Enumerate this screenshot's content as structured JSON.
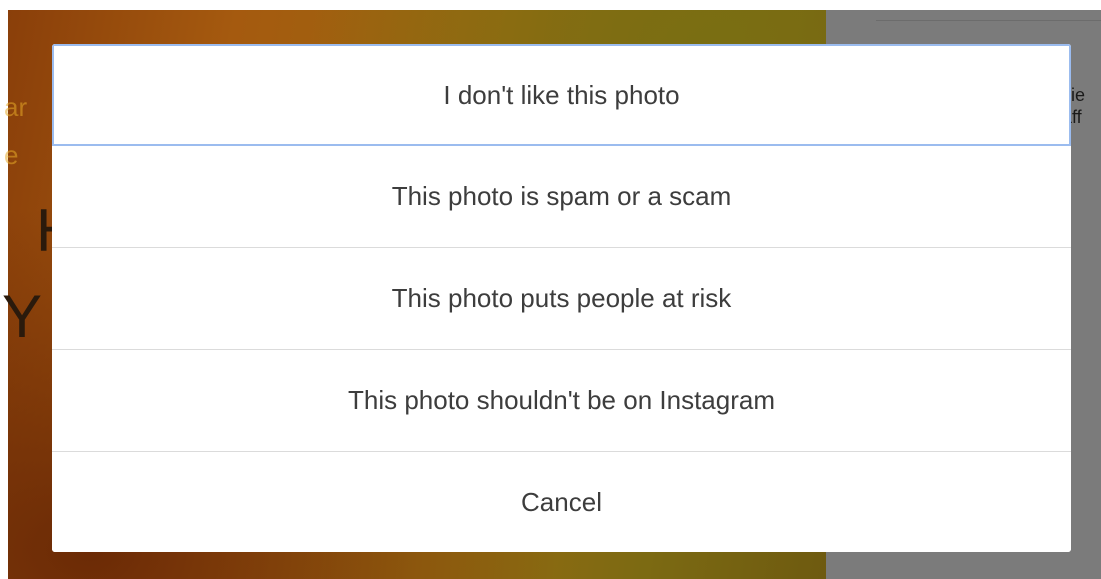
{
  "background": {
    "side_panel_text": [
      "kie",
      "aff"
    ],
    "left_glyphs": [
      "H",
      "Y"
    ],
    "faint_text": [
      "ar",
      "e"
    ]
  },
  "report_dialog": {
    "options": [
      {
        "label": "I don't like this photo"
      },
      {
        "label": "This photo is spam or a scam"
      },
      {
        "label": "This photo puts people at risk"
      },
      {
        "label": "This photo shouldn't be on Instagram"
      },
      {
        "label": "Cancel"
      }
    ],
    "focused_option": "I don't like this photo"
  },
  "colors": {
    "overlay_gray": "#7b7b7b",
    "focus_ring": "#9bbcef",
    "option_text": "#3d3d3d",
    "divider": "#dbdbdb"
  }
}
